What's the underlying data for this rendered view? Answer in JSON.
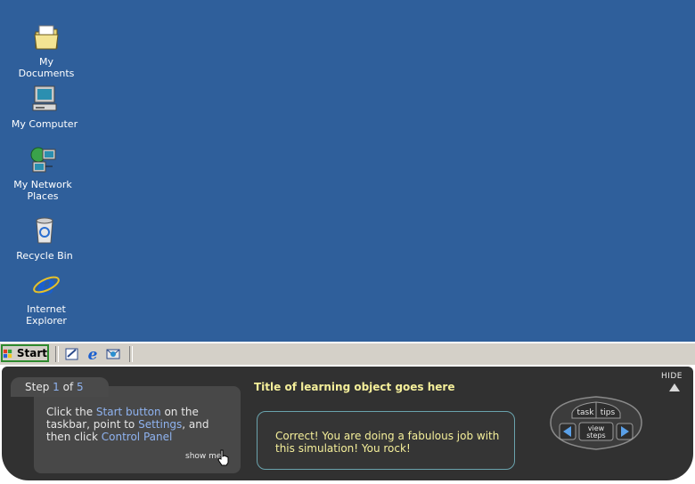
{
  "desktop": {
    "icons": [
      {
        "label": "My Documents",
        "icon": "my-documents-icon"
      },
      {
        "label": "My Computer",
        "icon": "my-computer-icon"
      },
      {
        "label": "My Network Places",
        "icon": "network-places-icon"
      },
      {
        "label": "Recycle Bin",
        "icon": "recycle-bin-icon"
      },
      {
        "label": "Internet Explorer",
        "icon": "internet-explorer-icon"
      }
    ],
    "background": "#2f5f9b"
  },
  "taskbar": {
    "start_label": "Start",
    "quick_launch": [
      "show-desktop-icon",
      "internet-explorer-icon",
      "outlook-express-icon"
    ]
  },
  "tutorial": {
    "hide_label": "HIDE",
    "step_prefix": "Step",
    "step_current": "1",
    "step_of": "of",
    "step_total": "5",
    "instruction": {
      "p1": "Click the ",
      "h1": "Start button",
      "p2": " on the taskbar, point to ",
      "h2": "Settings",
      "p3": ", and then click ",
      "h3": "Control Panel"
    },
    "show_me": "show me",
    "title": "Title of learning object goes here",
    "feedback": "Correct! You are doing a fabulous job with this simulation! You rock!",
    "nav": {
      "task": "task",
      "tips": "tips",
      "view_steps_1": "view",
      "view_steps_2": "steps"
    },
    "accent_color": "#8fb3f0",
    "title_color": "#f5ef9a"
  }
}
